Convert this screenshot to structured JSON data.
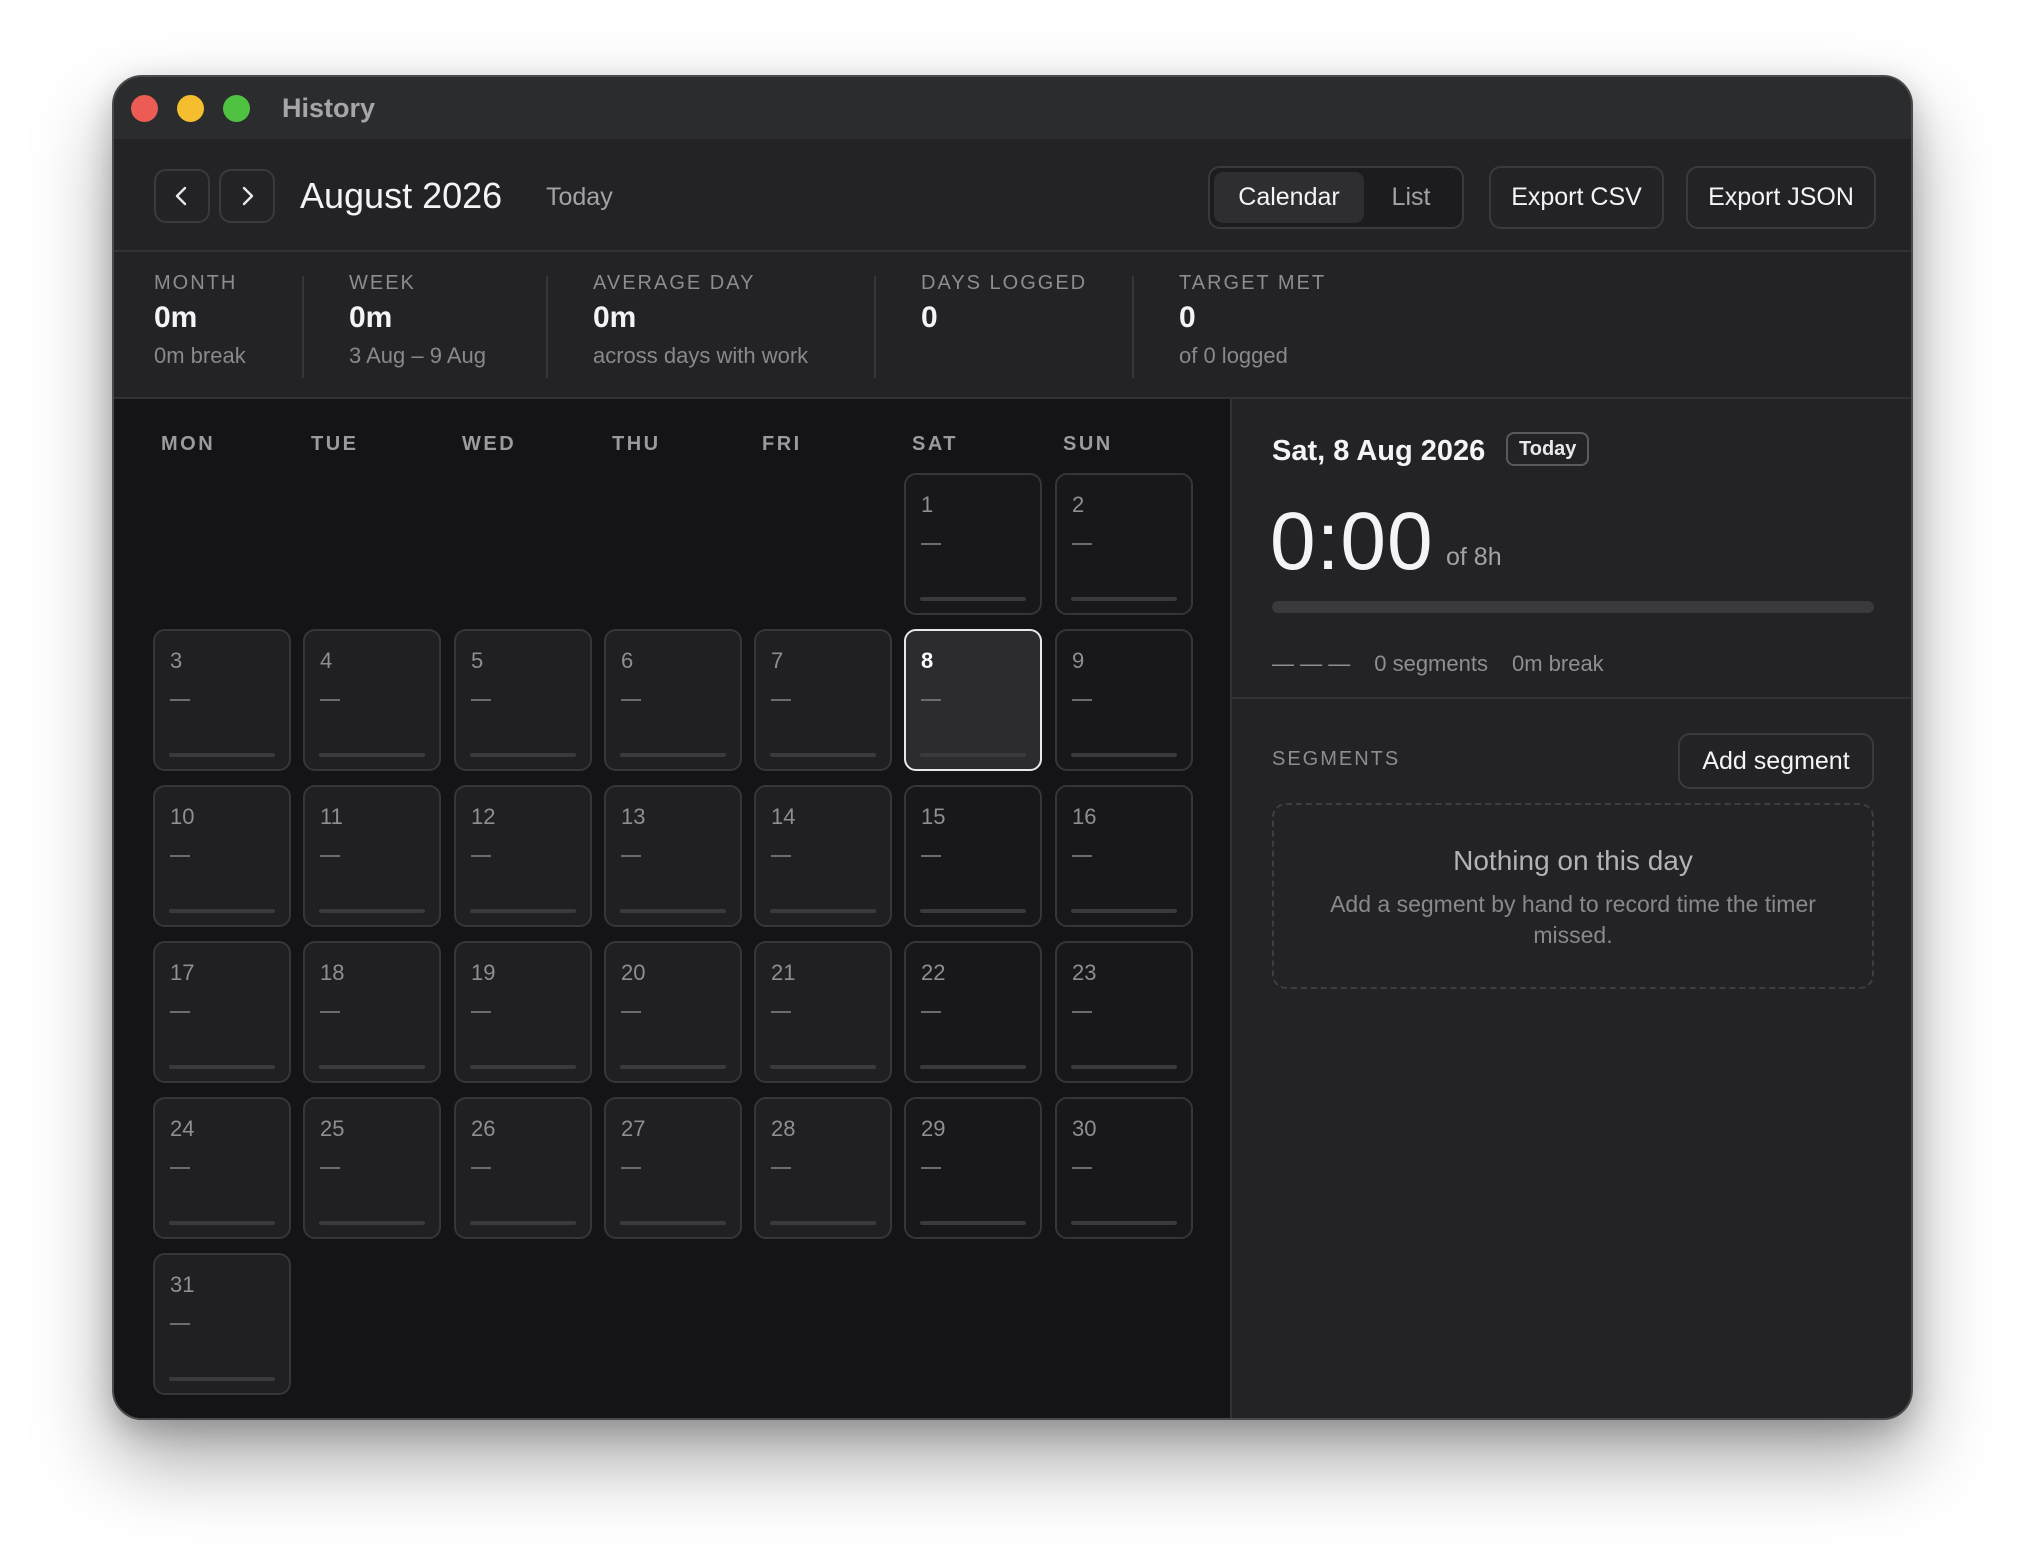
{
  "window": {
    "title": "History"
  },
  "toolbar": {
    "month_title": "August 2026",
    "today_label": "Today",
    "view_tabs": [
      "Calendar",
      "List"
    ],
    "active_view": "Calendar",
    "export_csv_label": "Export CSV",
    "export_json_label": "Export JSON"
  },
  "stats": [
    {
      "label": "MONTH",
      "value": "0m",
      "sub": "0m break"
    },
    {
      "label": "WEEK",
      "value": "0m",
      "sub": "3 Aug – 9 Aug"
    },
    {
      "label": "AVERAGE DAY",
      "value": "0m",
      "sub": "across days with work"
    },
    {
      "label": "DAYS LOGGED",
      "value": "0",
      "sub": ""
    },
    {
      "label": "TARGET MET",
      "value": "0",
      "sub": "of 0 logged"
    }
  ],
  "calendar": {
    "weekdays": [
      "MON",
      "TUE",
      "WED",
      "THU",
      "FRI",
      "SAT",
      "SUN"
    ],
    "first_weekday_index": 5,
    "days_in_month": 31,
    "selected_day": 8,
    "empty_value": "—"
  },
  "detail": {
    "date_label": "Sat, 8 Aug 2026",
    "badge": "Today",
    "time": "0:00",
    "target": "of 8h",
    "progress": 0,
    "range": "— — —",
    "segments_count": "0 segments",
    "break": "0m break",
    "segments_label": "SEGMENTS",
    "add_segment_label": "Add segment",
    "empty_title": "Nothing on this day",
    "empty_sub": "Add a segment by hand to record time the timer missed."
  },
  "colors": {
    "close": "#ed5b55",
    "minimize": "#f4be2e",
    "zoom": "#4fc241",
    "window_bg": "#1c1c1e",
    "calendar_bg": "#141416"
  }
}
